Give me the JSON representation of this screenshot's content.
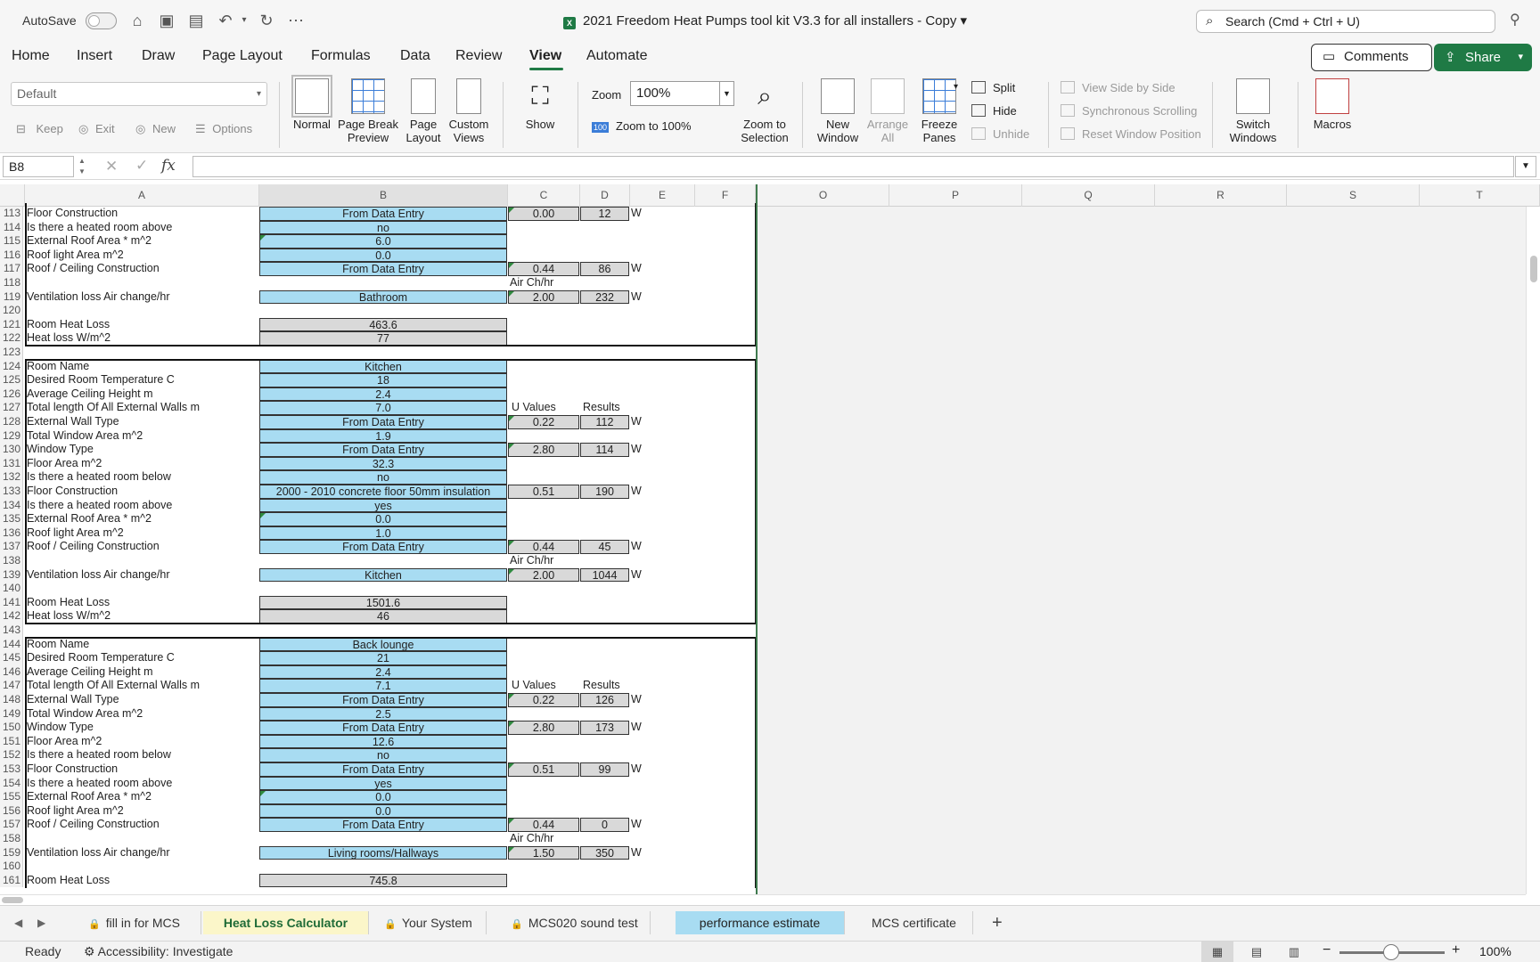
{
  "titlebar": {
    "autosave_label": "AutoSave",
    "doc_title": "2021 Freedom Heat Pumps tool kit V3.3 for all installers - Copy",
    "search_placeholder": "Search (Cmd + Ctrl + U)"
  },
  "ribbon_tabs": [
    "Home",
    "Insert",
    "Draw",
    "Page Layout",
    "Formulas",
    "Data",
    "Review",
    "View",
    "Automate"
  ],
  "active_tab": "View",
  "buttons": {
    "comments": "Comments",
    "share": "Share"
  },
  "ribbon": {
    "sheet_view_select": "Default",
    "keep": "Keep",
    "exit": "Exit",
    "new": "New",
    "options": "Options",
    "normal": "Normal",
    "page_break_1": "Page Break",
    "page_break_2": "Preview",
    "page_layout_1": "Page",
    "page_layout_2": "Layout",
    "custom_views_1": "Custom",
    "custom_views_2": "Views",
    "show": "Show",
    "zoom_label": "Zoom",
    "zoom_value": "100%",
    "zoom_to_100": "Zoom to 100%",
    "zoom_to_100_badge": "100",
    "zoom_sel_1": "Zoom to",
    "zoom_sel_2": "Selection",
    "new_window_1": "New",
    "new_window_2": "Window",
    "arrange_1": "Arrange",
    "arrange_2": "All",
    "freeze_1": "Freeze",
    "freeze_2": "Panes",
    "split": "Split",
    "hide": "Hide",
    "unhide": "Unhide",
    "side_by_side": "View Side by Side",
    "sync_scroll": "Synchronous Scrolling",
    "reset_window": "Reset Window Position",
    "switch_1": "Switch",
    "switch_2": "Windows",
    "macros": "Macros"
  },
  "formula_bar": {
    "name_box": "B8",
    "fx": "fx"
  },
  "columns_left": [
    "A",
    "B",
    "C",
    "D",
    "E",
    "F"
  ],
  "columns_right": [
    "O",
    "P",
    "Q",
    "R",
    "S",
    "T"
  ],
  "sheet_tabs": [
    {
      "label": "fill in for MCS",
      "locked": true
    },
    {
      "label": "Heat Loss Calculator",
      "locked": false,
      "active": true
    },
    {
      "label": "Your System",
      "locked": true
    },
    {
      "label": "MCS020 sound test",
      "locked": true
    },
    {
      "label": "performance estimate",
      "locked": false,
      "blue": true
    },
    {
      "label": "MCS certificate",
      "locked": false
    }
  ],
  "status": {
    "ready": "Ready",
    "accessibility": "Accessibility: Investigate",
    "zoom": "100%"
  },
  "grid": {
    "unit_w": "W",
    "header_u_values": "U Values",
    "header_results": "Results",
    "header_air": "Air Ch/hr",
    "rows": [
      {
        "n": "113",
        "a": "Floor Construction",
        "b": "From Data Entry",
        "bs": "blue",
        "c": "0.00",
        "d": "12",
        "e": "W",
        "tri": true
      },
      {
        "n": "114",
        "a": "Is there a heated room above",
        "b": "no",
        "bs": "blue"
      },
      {
        "n": "115",
        "a": "External Roof Area * m^2",
        "b": "6.0",
        "bs": "blue",
        "btri": true
      },
      {
        "n": "116",
        "a": "Roof light Area m^2",
        "b": "0.0",
        "bs": "blue"
      },
      {
        "n": "117",
        "a": "Roof / Ceiling Construction",
        "b": "From Data Entry",
        "bs": "blue",
        "c": "0.44",
        "d": "86",
        "e": "W",
        "tri": true
      },
      {
        "n": "118",
        "a": "",
        "hdr": "air"
      },
      {
        "n": "119",
        "a": "Ventilation loss Air change/hr",
        "b": "Bathroom",
        "bs": "blue",
        "c": "2.00",
        "d": "232",
        "e": "W",
        "tri": true
      },
      {
        "n": "120",
        "a": ""
      },
      {
        "n": "121",
        "a": "Room Heat Loss",
        "b": "463.6",
        "bs": "grey"
      },
      {
        "n": "122",
        "a": "Heat loss W/m^2",
        "b": "77",
        "bs": "grey"
      },
      {
        "n": "123",
        "a": ""
      },
      {
        "n": "124",
        "a": "Room Name",
        "b": "Kitchen",
        "bs": "blue"
      },
      {
        "n": "125",
        "a": "Desired Room Temperature C",
        "b": "18",
        "bs": "blue"
      },
      {
        "n": "126",
        "a": "Average Ceiling Height m",
        "b": "2.4",
        "bs": "blue"
      },
      {
        "n": "127",
        "a": "Total length Of All External Walls m",
        "b": "7.0",
        "bs": "blue",
        "hdr": "uv"
      },
      {
        "n": "128",
        "a": "External Wall Type",
        "b": "From Data Entry",
        "bs": "blue",
        "c": "0.22",
        "d": "112",
        "e": "W",
        "tri": true
      },
      {
        "n": "129",
        "a": "Total Window Area m^2",
        "b": "1.9",
        "bs": "blue"
      },
      {
        "n": "130",
        "a": "Window Type",
        "b": "From Data Entry",
        "bs": "blue",
        "c": "2.80",
        "d": "114",
        "e": "W",
        "tri": true
      },
      {
        "n": "131",
        "a": "Floor Area m^2",
        "b": "32.3",
        "bs": "blue"
      },
      {
        "n": "132",
        "a": "Is there a heated room below",
        "b": "no",
        "bs": "blue"
      },
      {
        "n": "133",
        "a": "Floor Construction",
        "b": "2000 - 2010 concrete floor 50mm insulation",
        "bs": "blue",
        "c": "0.51",
        "d": "190",
        "e": "W"
      },
      {
        "n": "134",
        "a": "Is there a heated room above",
        "b": "yes",
        "bs": "blue"
      },
      {
        "n": "135",
        "a": "External Roof Area * m^2",
        "b": "0.0",
        "bs": "blue",
        "btri": true
      },
      {
        "n": "136",
        "a": "Roof light Area m^2",
        "b": "1.0",
        "bs": "blue"
      },
      {
        "n": "137",
        "a": "Roof / Ceiling Construction",
        "b": "From Data Entry",
        "bs": "blue",
        "c": "0.44",
        "d": "45",
        "e": "W",
        "tri": true
      },
      {
        "n": "138",
        "a": "",
        "hdr": "air"
      },
      {
        "n": "139",
        "a": "Ventilation loss Air change/hr",
        "b": "Kitchen",
        "bs": "blue",
        "c": "2.00",
        "d": "1044",
        "e": "W",
        "tri": true
      },
      {
        "n": "140",
        "a": ""
      },
      {
        "n": "141",
        "a": "Room Heat Loss",
        "b": "1501.6",
        "bs": "grey"
      },
      {
        "n": "142",
        "a": "Heat loss W/m^2",
        "b": "46",
        "bs": "grey"
      },
      {
        "n": "143",
        "a": ""
      },
      {
        "n": "144",
        "a": "Room Name",
        "b": "Back lounge",
        "bs": "blue"
      },
      {
        "n": "145",
        "a": "Desired Room Temperature C",
        "b": "21",
        "bs": "blue"
      },
      {
        "n": "146",
        "a": "Average Ceiling Height m",
        "b": "2.4",
        "bs": "blue"
      },
      {
        "n": "147",
        "a": "Total length Of All External Walls m",
        "b": "7.1",
        "bs": "blue",
        "hdr": "uv"
      },
      {
        "n": "148",
        "a": "External Wall Type",
        "b": "From Data Entry",
        "bs": "blue",
        "c": "0.22",
        "d": "126",
        "e": "W",
        "tri": true
      },
      {
        "n": "149",
        "a": "Total Window Area m^2",
        "b": "2.5",
        "bs": "blue"
      },
      {
        "n": "150",
        "a": "Window Type",
        "b": "From Data Entry",
        "bs": "blue",
        "c": "2.80",
        "d": "173",
        "e": "W",
        "tri": true
      },
      {
        "n": "151",
        "a": "Floor Area m^2",
        "b": "12.6",
        "bs": "blue"
      },
      {
        "n": "152",
        "a": "Is there a heated room below",
        "b": "no",
        "bs": "blue"
      },
      {
        "n": "153",
        "a": "Floor Construction",
        "b": "From Data Entry",
        "bs": "blue",
        "c": "0.51",
        "d": "99",
        "e": "W",
        "tri": true
      },
      {
        "n": "154",
        "a": "Is there a heated room above",
        "b": "yes",
        "bs": "blue"
      },
      {
        "n": "155",
        "a": "External Roof Area * m^2",
        "b": "0.0",
        "bs": "blue",
        "btri": true
      },
      {
        "n": "156",
        "a": "Roof light Area m^2",
        "b": "0.0",
        "bs": "blue"
      },
      {
        "n": "157",
        "a": "Roof / Ceiling Construction",
        "b": "From Data Entry",
        "bs": "blue",
        "c": "0.44",
        "d": "0",
        "e": "W",
        "tri": true
      },
      {
        "n": "158",
        "a": "",
        "hdr": "air"
      },
      {
        "n": "159",
        "a": "Ventilation loss Air change/hr",
        "b": "Living rooms/Hallways",
        "bs": "blue",
        "c": "1.50",
        "d": "350",
        "e": "W",
        "tri": true
      },
      {
        "n": "160",
        "a": ""
      },
      {
        "n": "161",
        "a": "Room Heat Loss",
        "b": "745.8",
        "bs": "grey"
      }
    ]
  }
}
